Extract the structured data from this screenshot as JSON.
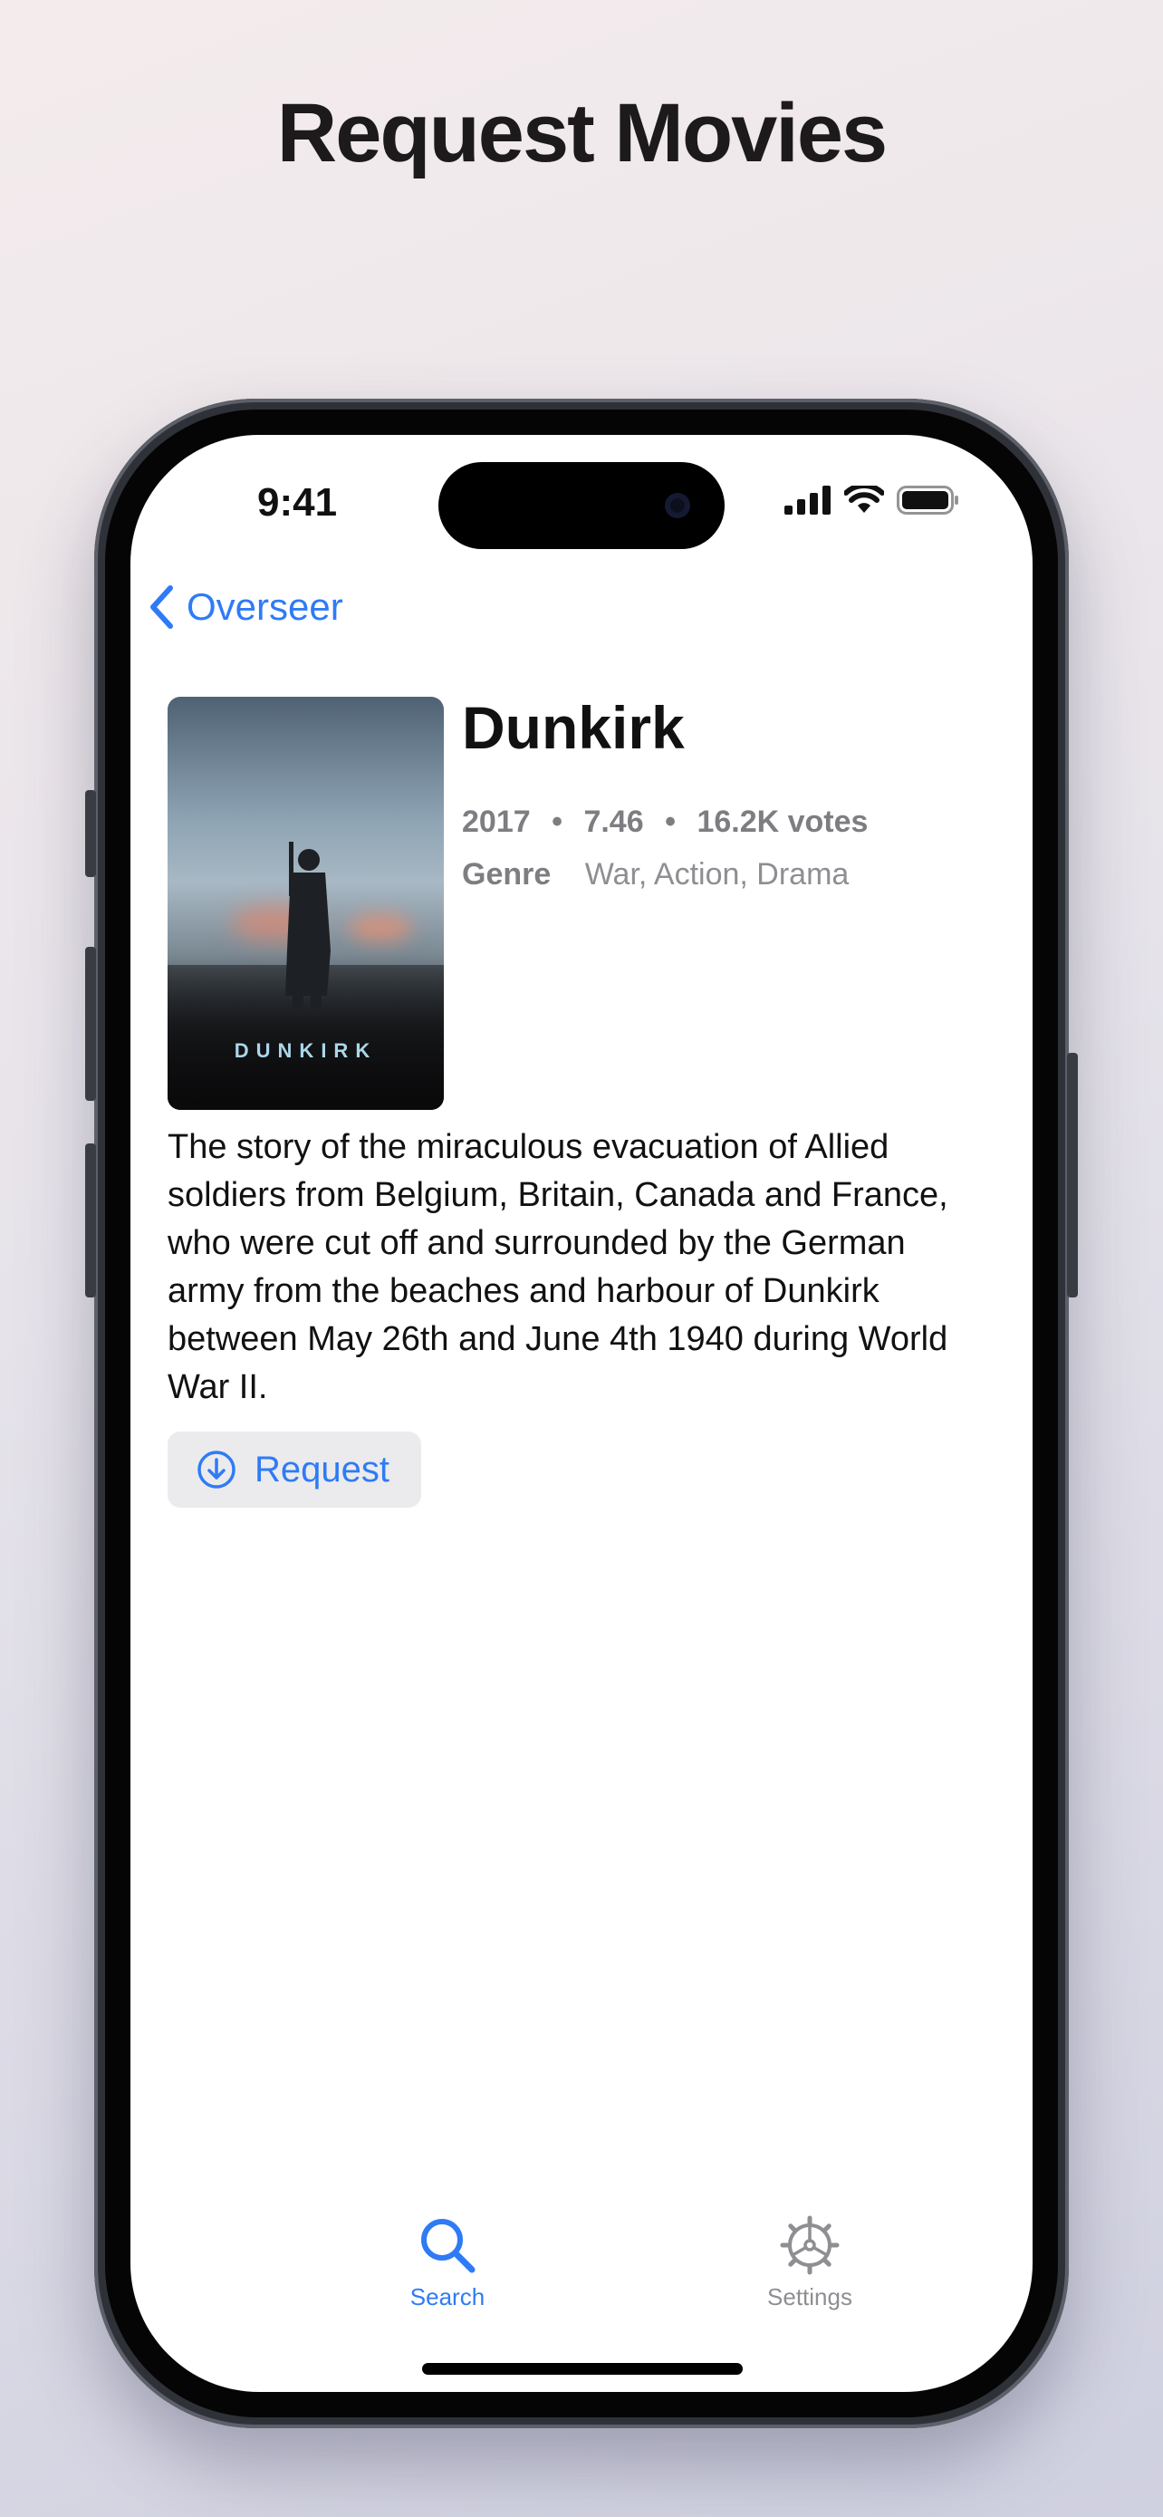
{
  "headline": "Request Movies",
  "status_bar": {
    "time": "9:41"
  },
  "nav": {
    "back_label": "Overseer"
  },
  "movie": {
    "poster_title": "DUNKIRK",
    "title": "Dunkirk",
    "year": "2017",
    "rating": "7.46",
    "votes": "16.2K votes",
    "separator": "•",
    "genre_label": "Genre",
    "genres": "War, Action, Drama",
    "overview": "The story of the miraculous evacuation of Allied soldiers from Belgium, Britain, Canada and France, who were cut off and surrounded by the German army from the beaches and harbour of Dunkirk between May 26th and June 4th 1940 during World War II."
  },
  "actions": {
    "request_label": "Request"
  },
  "tabs": [
    {
      "label": "Search",
      "icon": "search-icon",
      "selected": true
    },
    {
      "label": "Settings",
      "icon": "gear-icon",
      "selected": false
    }
  ],
  "colors": {
    "accent": "#2f7bf6",
    "inactive": "#8e8e93"
  }
}
